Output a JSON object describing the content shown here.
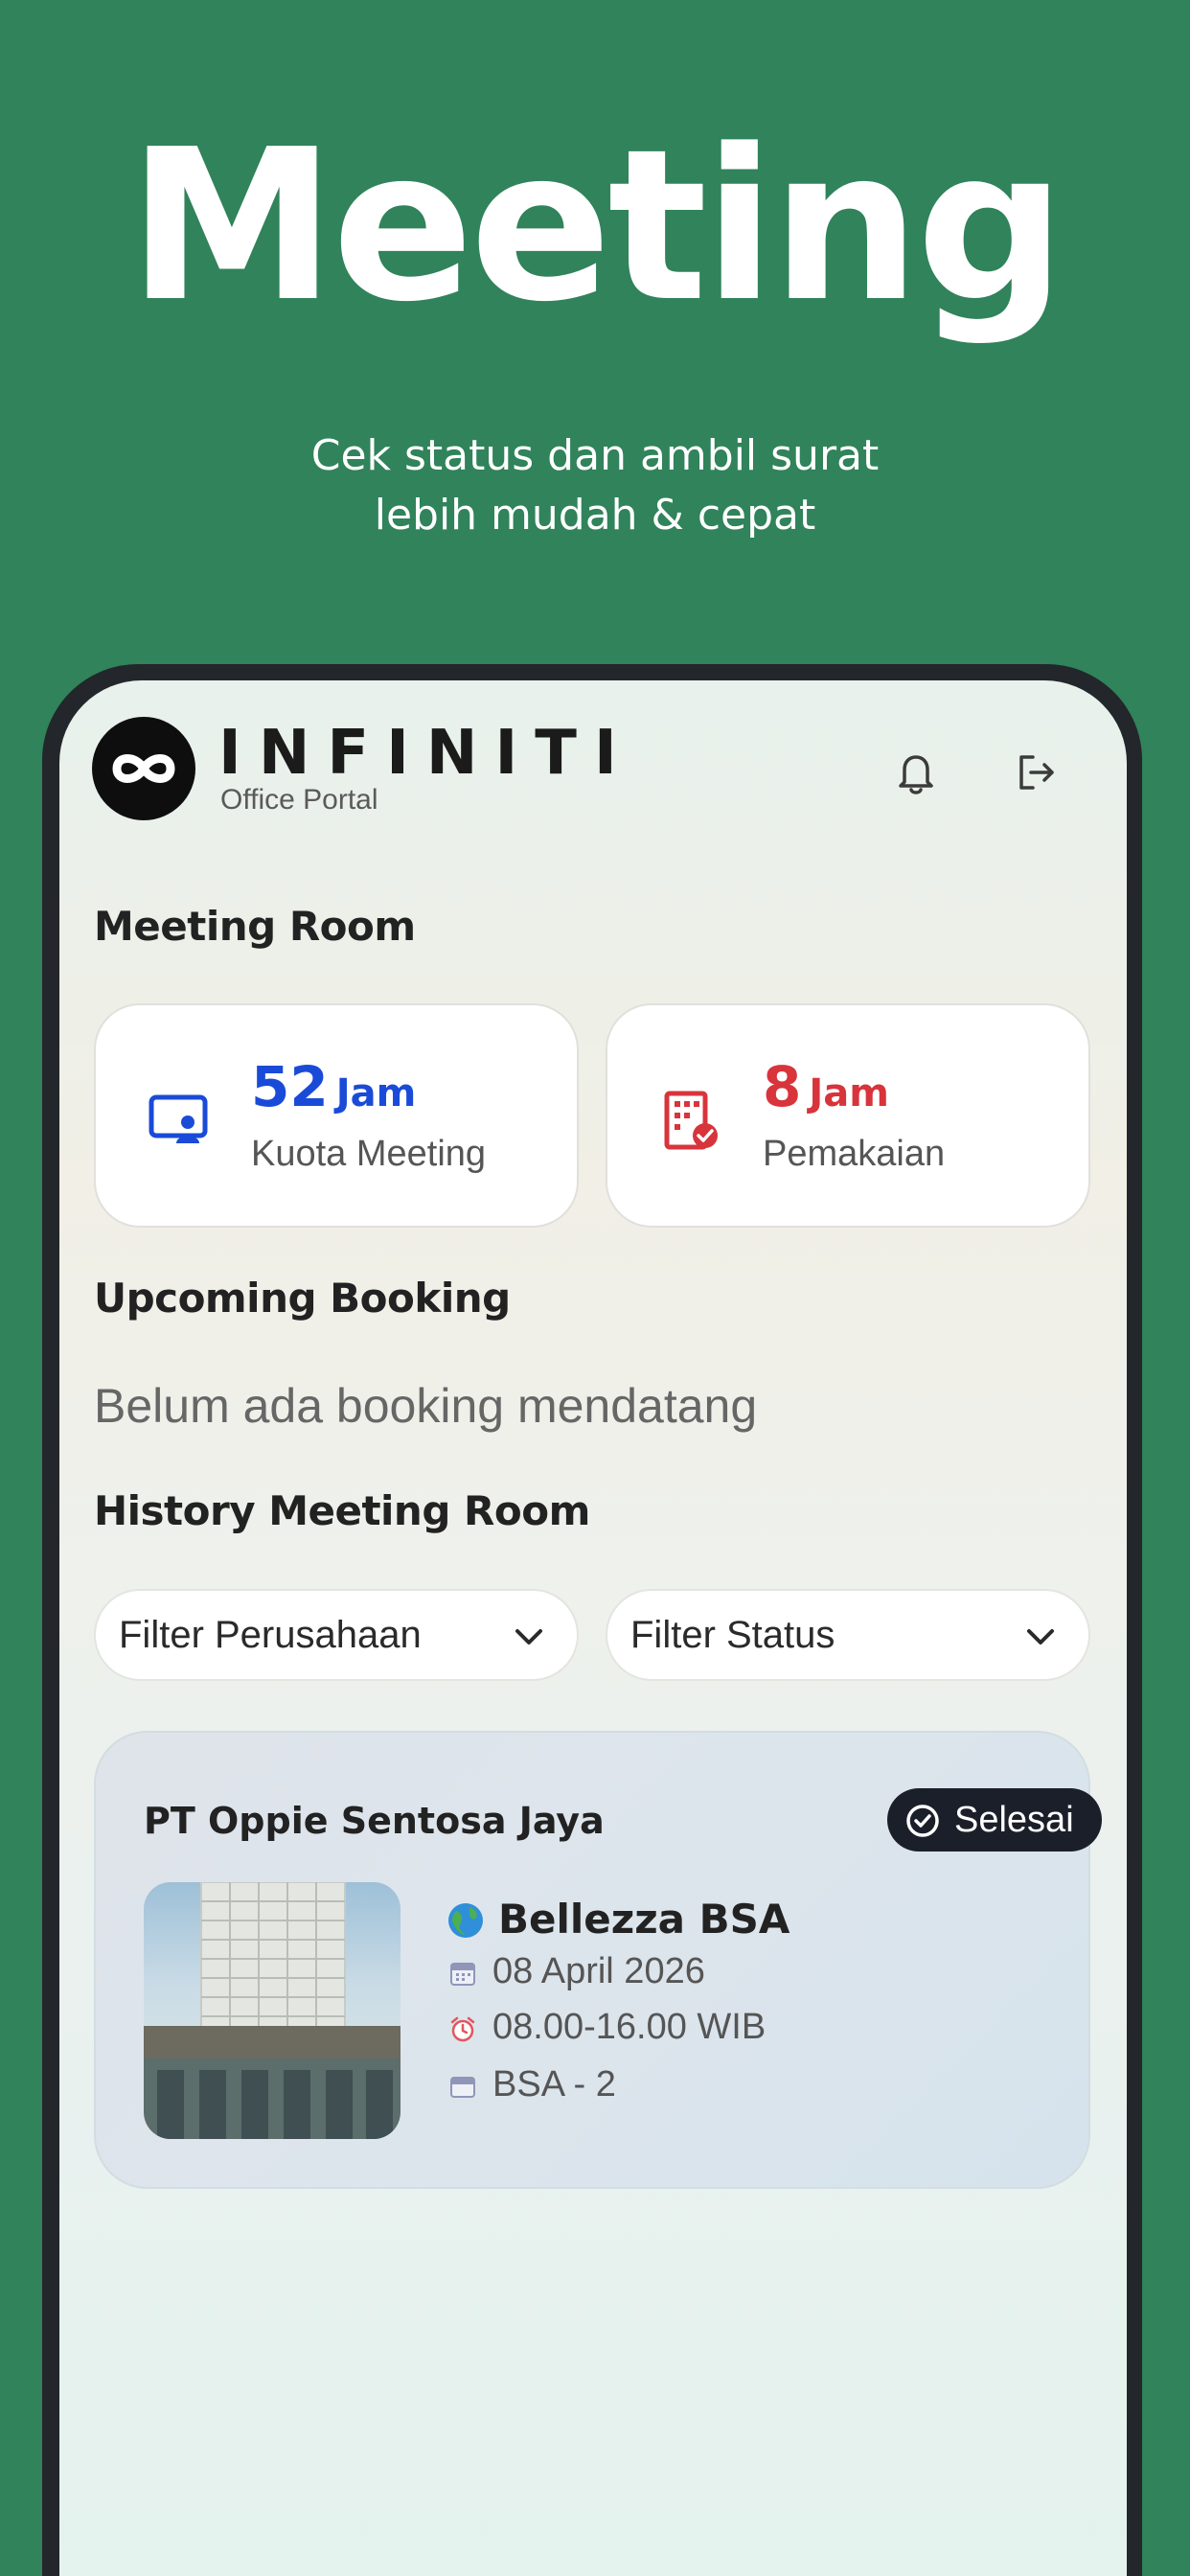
{
  "hero": {
    "title": "Meeting",
    "subtitle_line1": "Cek status dan ambil surat",
    "subtitle_line2": "lebih mudah & cepat"
  },
  "header": {
    "brand": "INFINITI",
    "brand_sub": "Office Portal",
    "icons": [
      "bell-icon",
      "logout-icon"
    ]
  },
  "meeting_room": {
    "title": "Meeting Room",
    "quota": {
      "value": "52",
      "unit": "Jam",
      "label": "Kuota Meeting",
      "icon": "screen-user-icon",
      "color": "#1a4bd8"
    },
    "usage": {
      "value": "8",
      "unit": "Jam",
      "label": "Pemakaian",
      "icon": "building-check-icon",
      "color": "#d8343c"
    }
  },
  "upcoming": {
    "title": "Upcoming Booking",
    "empty_text": "Belum ada booking mendatang"
  },
  "history": {
    "title": "History Meeting Room",
    "filter_company": "Filter Perusahaan",
    "filter_status": "Filter Status",
    "bookings": [
      {
        "company": "PT Oppie Sentosa Jaya",
        "status": "Selesai",
        "venue": "Bellezza BSA",
        "date": "08 April 2026",
        "time": "08.00-16.00 WIB",
        "room": "BSA - 2"
      }
    ]
  },
  "colors": {
    "background": "#30835a",
    "accent_blue": "#1a4bd8",
    "accent_red": "#d8343c"
  }
}
